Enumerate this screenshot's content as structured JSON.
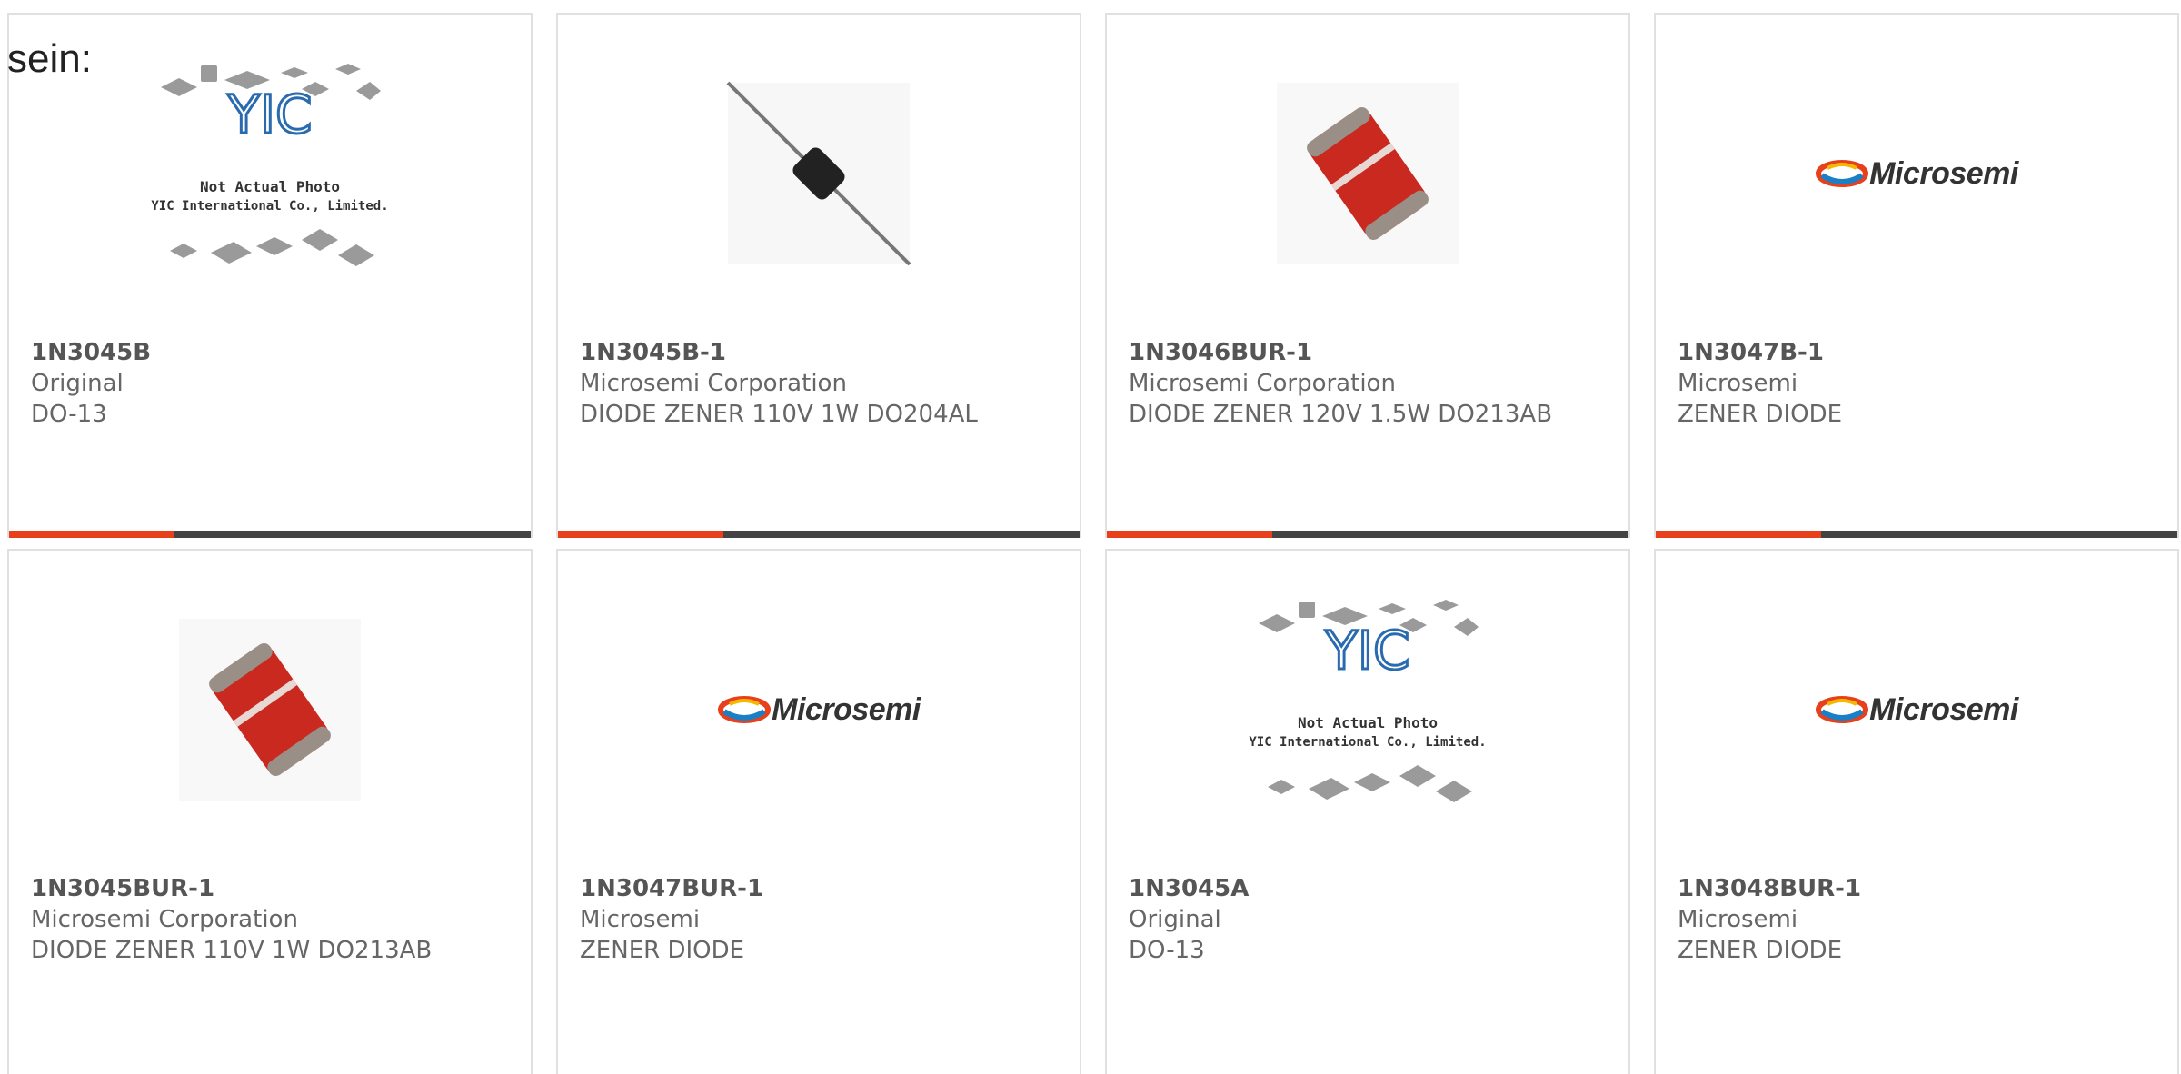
{
  "intro_text": "sein:",
  "colors": {
    "accent": "#e8401a",
    "bar": "#444444"
  },
  "products": [
    {
      "part_number": "1N3045B",
      "manufacturer": "Original",
      "description": "DO-13",
      "image": "yic-placeholder",
      "placeholder_line1": "Not Actual Photo",
      "placeholder_line2": "YIC International Co., Limited."
    },
    {
      "part_number": "1N3045B-1",
      "manufacturer": "Microsemi Corporation",
      "description": "DIODE ZENER 110V 1W DO204AL",
      "image": "axial-diode"
    },
    {
      "part_number": "1N3046BUR-1",
      "manufacturer": "Microsemi Corporation",
      "description": "DIODE ZENER 120V 1.5W DO213AB",
      "image": "melf-diode"
    },
    {
      "part_number": "1N3047B-1",
      "manufacturer": "Microsemi",
      "description": "ZENER DIODE",
      "image": "microsemi-logo",
      "logo_text": "Microsemi"
    },
    {
      "part_number": "1N3045BUR-1",
      "manufacturer": "Microsemi Corporation",
      "description": "DIODE ZENER 110V 1W DO213AB",
      "image": "melf-diode"
    },
    {
      "part_number": "1N3047BUR-1",
      "manufacturer": "Microsemi",
      "description": "ZENER DIODE",
      "image": "microsemi-logo",
      "logo_text": "Microsemi"
    },
    {
      "part_number": "1N3045A",
      "manufacturer": "Original",
      "description": "DO-13",
      "image": "yic-placeholder",
      "placeholder_line1": "Not Actual Photo",
      "placeholder_line2": "YIC International Co., Limited."
    },
    {
      "part_number": "1N3048BUR-1",
      "manufacturer": "Microsemi",
      "description": "ZENER DIODE",
      "image": "microsemi-logo",
      "logo_text": "Microsemi"
    }
  ]
}
